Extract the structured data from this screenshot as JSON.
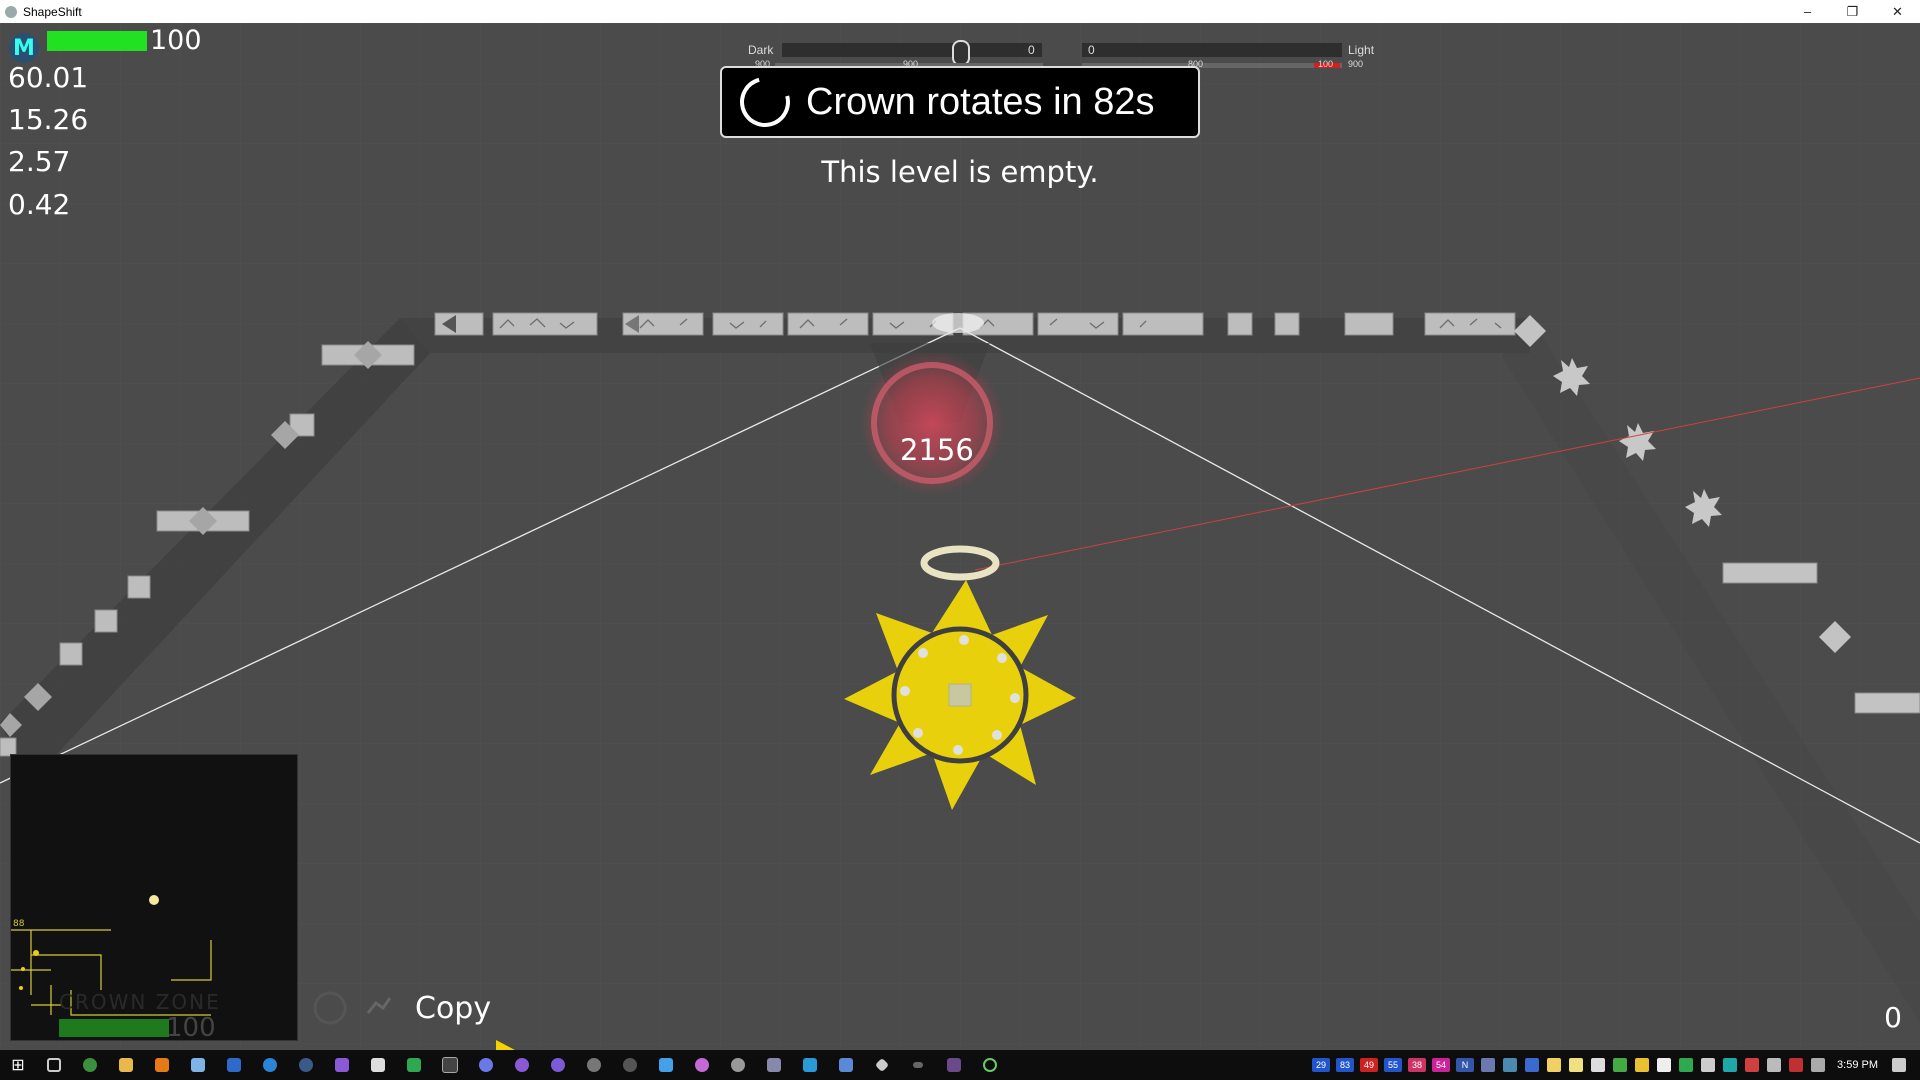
{
  "window": {
    "title": "ShapeShift",
    "controls": [
      "–",
      "❐",
      "✕"
    ]
  },
  "hud": {
    "avatar_letter": "M",
    "health_value": "100",
    "health_fraction": 1.0,
    "stats": [
      "60.01",
      "15.26",
      "2.57",
      "0.42"
    ]
  },
  "balance_slider": {
    "dark_label": "Dark",
    "light_label": "Light",
    "left_value": "0",
    "right_value": "0",
    "sub_left": "900",
    "sub_mid": "900",
    "sub_right_mid": "800",
    "sub_red": "100",
    "sub_right": "900"
  },
  "crown_timer": {
    "text": "Crown rotates in 82s"
  },
  "level_message": "This level is empty.",
  "score_display": "2156",
  "minimap": {
    "zone_label": "CROWN ZONE",
    "zone_value": "100",
    "marker_label": "88"
  },
  "ability": {
    "label": "Copy"
  },
  "bottom_right_counter": "0",
  "taskbar": {
    "badges": [
      {
        "text": "29",
        "color": "#2255cc"
      },
      {
        "text": "83",
        "color": "#2255cc"
      },
      {
        "text": "49",
        "color": "#cc2222"
      },
      {
        "text": "55",
        "color": "#2255cc"
      },
      {
        "text": "38",
        "color": "#cc3366"
      },
      {
        "text": "54",
        "color": "#cc2299"
      },
      {
        "text": "N",
        "color": "#3355aa"
      }
    ],
    "clock": "3:59 PM"
  },
  "colors": {
    "sun": "#e8d10c",
    "health": "#22e022",
    "aura": "#d0485a"
  }
}
